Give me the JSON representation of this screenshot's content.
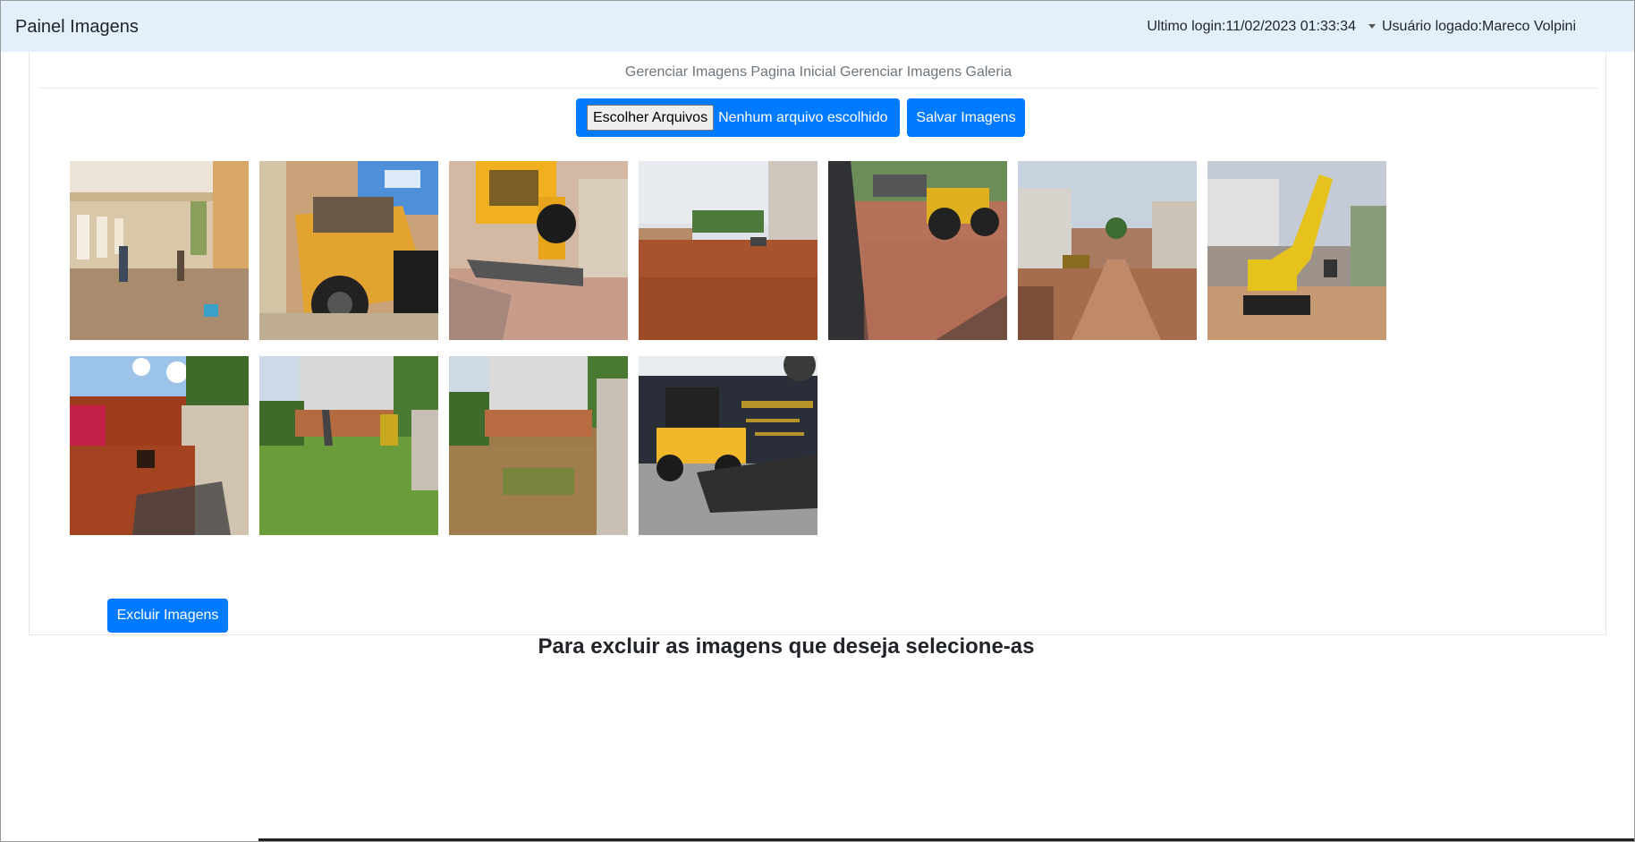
{
  "navbar": {
    "brand": "Painel Imagens",
    "last_login": "Ultimo login:11/02/2023 01:33:34",
    "user_logged": "Usuário logado:Mareco Volpini"
  },
  "subnav": {
    "home_images": "Gerenciar Imagens Pagina Inicial",
    "gallery_images": "Gerenciar Imagens Galeria"
  },
  "upload": {
    "choose_button": "Escolher Arquivos",
    "no_file_text": "Nenhum arquivo escolhido",
    "save_button": "Salvar Imagens"
  },
  "gallery": {
    "delete_button": "Excluir Imagens",
    "hint": "Para excluir as imagens que deseja selecione-as",
    "image_count": 11
  },
  "colors": {
    "navbar_bg": "#e3f0fc",
    "primary": "#007bff",
    "soil": "#a14a26",
    "grass": "#5f8d3a",
    "machine_yellow": "#f0b020"
  }
}
